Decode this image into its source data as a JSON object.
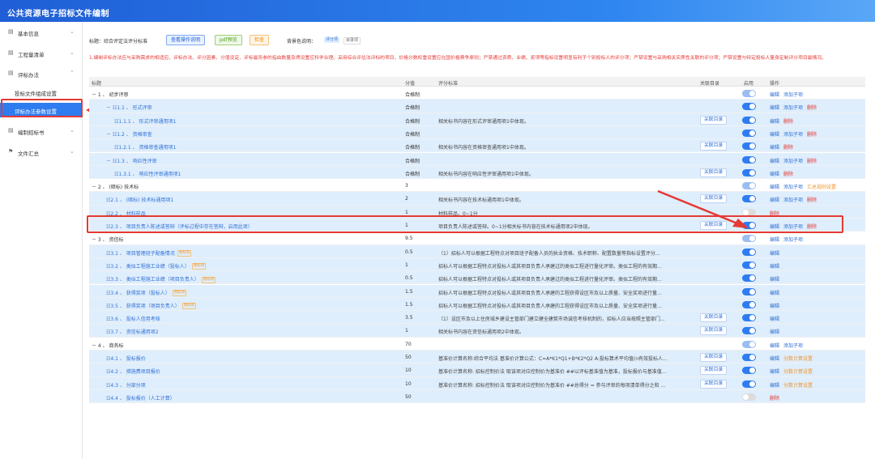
{
  "app": {
    "title": "公共资源电子招标文件编制"
  },
  "sidebar": {
    "items": [
      {
        "label": "基本信息",
        "icon": "doc-icon"
      },
      {
        "label": "工程量清单",
        "icon": "doc-icon"
      },
      {
        "label": "评标办法",
        "icon": "doc-icon"
      },
      {
        "label": "编制招标书",
        "icon": "doc-icon"
      },
      {
        "label": "文件汇总",
        "icon": "flag-icon"
      }
    ],
    "sub_items": [
      {
        "label": "投标文件组成设置"
      },
      {
        "label": "评标办法参数设置"
      }
    ]
  },
  "toolbar": {
    "title_label": "标题：综合评定法评分标准",
    "btn_help": "查看操作说明",
    "btn_pdf": "pdf预览",
    "btn_check": "检查",
    "bg_label": "背景色说明：",
    "bg_tag1": "评分项",
    "bg_tag2": "目录项"
  },
  "notice": "1.编制评标办法应与采购需求的相适应。评标办法、评分因素、分值设定、评标最员参的指由数量及得设置应科学合理。采用综合评估法评标的项目，价格分数权重设置应在国价格费争原则；严禁通过资质、业绩、奖项等指标设置明显有利于个别投标人的评分项；严禁设置与采购相关实质性关联的评分项；严禁设置与特定投标人量身定制评分项目最情况。",
  "table": {
    "headers": {
      "name": "标题",
      "score": "分值",
      "std": "评分标准",
      "catalog": "关联目录",
      "enable": "启用",
      "ops": "操作"
    },
    "ops_labels": {
      "edit": "编辑",
      "add": "添加子项",
      "del": "删除",
      "sum": "汇总规则设置",
      "score_set": "分数计算设置"
    },
    "catalog_btn": "关联目录",
    "rows": [
      {
        "name": "－ 1 、 初步评审",
        "score": "合格制",
        "std": "",
        "cat": false,
        "tg": "half",
        "ops": [
          "edit",
          "add"
        ],
        "lv": "lv1",
        "ind": 0
      },
      {
        "name": "－ ☷1.1 、 形式评审",
        "score": "合格制",
        "std": "",
        "cat": false,
        "tg": "on",
        "ops": [
          "edit",
          "add",
          "del"
        ],
        "lv": "lv2",
        "ind": 18
      },
      {
        "name": "☷1.1.1 、 形式评审通用项1",
        "score": "合格制",
        "std": "相关标书内容在形式评审通用项1中体现。",
        "cat": true,
        "tg": "on",
        "ops": [
          "edit",
          "del"
        ],
        "lv": "lv2",
        "ind": 28
      },
      {
        "name": "－ ☷1.2 、 资格审查",
        "score": "合格制",
        "std": "",
        "cat": false,
        "tg": "on",
        "ops": [
          "edit",
          "add",
          "del"
        ],
        "lv": "lv2",
        "ind": 18
      },
      {
        "name": "☷1.2.1 、 资格审查通用项1",
        "score": "合格制",
        "std": "相关标书内容在资格审查通用项1中体现。",
        "cat": true,
        "tg": "on",
        "ops": [
          "edit",
          "del"
        ],
        "lv": "lv2",
        "ind": 28
      },
      {
        "name": "－ ☷1.3 、 响应性评审",
        "score": "合格制",
        "std": "",
        "cat": false,
        "tg": "on",
        "ops": [
          "edit",
          "add",
          "del"
        ],
        "lv": "lv2",
        "ind": 18
      },
      {
        "name": "☷1.3.1 、 响应性评审通用项1",
        "score": "合格制",
        "std": "相关标书内容在响应性评审通用项1中体现。",
        "cat": true,
        "tg": "on",
        "ops": [
          "edit",
          "del"
        ],
        "lv": "lv2",
        "ind": 28
      },
      {
        "name": "－ 2 、 (暗标) 技术标",
        "score": "3",
        "std": "",
        "cat": false,
        "tg": "half",
        "ops": [
          "edit",
          "add",
          "sum"
        ],
        "lv": "lv1",
        "ind": 0
      },
      {
        "name": "☷2.1 、 (暗标) 技术标通用项1",
        "score": "2",
        "std": "相关标书内容在技术标通用项1中体现。",
        "cat": true,
        "tg": "on",
        "ops": [
          "edit",
          "add",
          "del"
        ],
        "lv": "lv2",
        "ind": 18
      },
      {
        "name": "☷2.2 、 材料样品",
        "score": "1",
        "std": "材料样品，0~1分",
        "cat": false,
        "tg": "off",
        "ops": [
          "del"
        ],
        "lv": "lv2",
        "ind": 18
      },
      {
        "name": "☷2.3 、 项目负责人陈述或答辩（评标过程中存在答辩，启用此项）",
        "score": "1",
        "std": "项目负责人陈述或答辩。0~1分相关标书内容在技术标通用项2中体现。",
        "cat": true,
        "tg": "on",
        "ops": [
          "edit",
          "add",
          "del"
        ],
        "lv": "lv2",
        "ind": 18
      },
      {
        "name": "－ 3 、 资信标",
        "score": "9.5",
        "std": "",
        "cat": false,
        "tg": "half",
        "ops": [
          "edit",
          "add"
        ],
        "lv": "lv1",
        "ind": 0
      },
      {
        "name": "☷3.1 、 项目管理班子配备情况",
        "badge": "暗标项",
        "score": "0.5",
        "std": "（1）招标人可以根据工程特点对项目班子配备人员的执业资格、技术职称、配置数量等指标设置评分...",
        "cat": false,
        "tg": "on",
        "ops": [
          "edit"
        ],
        "lv": "lv2",
        "ind": 18
      },
      {
        "name": "☷3.2 、 类似工程施工业绩（投标人）",
        "badge": "暗标项",
        "score": "1",
        "std": "招标人可以根据工程特点对投标人或其项目负责人承建过的类似工程进行量化评审。类似工程的有效期...",
        "cat": false,
        "tg": "on",
        "ops": [
          "edit"
        ],
        "lv": "lv2",
        "ind": 18
      },
      {
        "name": "☷3.3 、 类似工程施工业绩（项目负责人）",
        "badge": "暗标项",
        "score": "0.5",
        "std": "招标人可以根据工程特点对投标人或其项目负责人承建过的类似工程进行量化评审。类似工程的有效期...",
        "cat": false,
        "tg": "on",
        "ops": [
          "edit"
        ],
        "lv": "lv2",
        "ind": 18
      },
      {
        "name": "☷3.4 、 获得奖项（投标人）",
        "badge": "暗标项",
        "score": "1.5",
        "std": "招标人可以根据工程特点对投标人或其项目负责人承建的工程获得设区市及以上质量、安全奖项进行量...",
        "cat": false,
        "tg": "on",
        "ops": [
          "edit"
        ],
        "lv": "lv2",
        "ind": 18
      },
      {
        "name": "☷3.5 、 获得奖项（项目负责人）",
        "badge": "暗标项",
        "score": "1.5",
        "std": "招标人可以根据工程特点对投标人或其项目负责人承建的工程获得设区市及以上质量、安全奖项进行量...",
        "cat": false,
        "tg": "on",
        "ops": [
          "edit"
        ],
        "lv": "lv2",
        "ind": 18
      },
      {
        "name": "☷3.6 、 投标人信用考核",
        "score": "3.5",
        "std": "（1）设区市及以上住房城乡建设主管部门建立健全建筑市场诚信考核机制的，招标人应当按照主管部门...",
        "cat": true,
        "tg": "on",
        "ops": [
          "edit"
        ],
        "lv": "lv2",
        "ind": 18
      },
      {
        "name": "☷3.7 、 资信标通用项2",
        "score": "1",
        "std": "相关标书内容在资信标通用项2中体现。",
        "cat": true,
        "tg": "on",
        "ops": [
          "edit"
        ],
        "lv": "lv2",
        "ind": 18
      },
      {
        "name": "－ 4 、 商务标",
        "score": "70",
        "std": "",
        "cat": false,
        "tg": "half",
        "ops": [
          "edit",
          "add"
        ],
        "lv": "lv1",
        "ind": 0
      },
      {
        "name": "☷4.1 、 投标报价",
        "score": "50",
        "std": "基准价计算名称:综合平均法 基准价计算公式：C=A*K1*Q1+B*K2*Q2 A:投标算术平均值(n有效投标人...",
        "cat": true,
        "tg": "on",
        "ops": [
          "edit",
          "score_set"
        ],
        "lv": "lv2",
        "ind": 18
      },
      {
        "name": "☷4.2 、 措施费项目报价",
        "score": "10",
        "std": "基准价计算名称: 招标控制价法 取该项对应控制价为基准价 ##以评标基准值为基准，投标报价与基准值...",
        "cat": true,
        "tg": "on",
        "ops": [
          "edit",
          "score_set"
        ],
        "lv": "lv2",
        "ind": 18
      },
      {
        "name": "☷4.3 、 分部分项",
        "score": "10",
        "std": "基准价计算名称: 招标控制价法 取该项对应控制价为基准价 ##总得分 = 参与评审的每项清单得分之和 ...",
        "cat": true,
        "tg": "on",
        "ops": [
          "edit",
          "score_set"
        ],
        "lv": "lv2",
        "ind": 18
      },
      {
        "name": "☷4.4 、 投标报价（人工计算）",
        "score": "50",
        "std": "",
        "cat": false,
        "tg": "off",
        "ops": [
          "del"
        ],
        "lv": "lv2",
        "ind": 18
      }
    ]
  }
}
